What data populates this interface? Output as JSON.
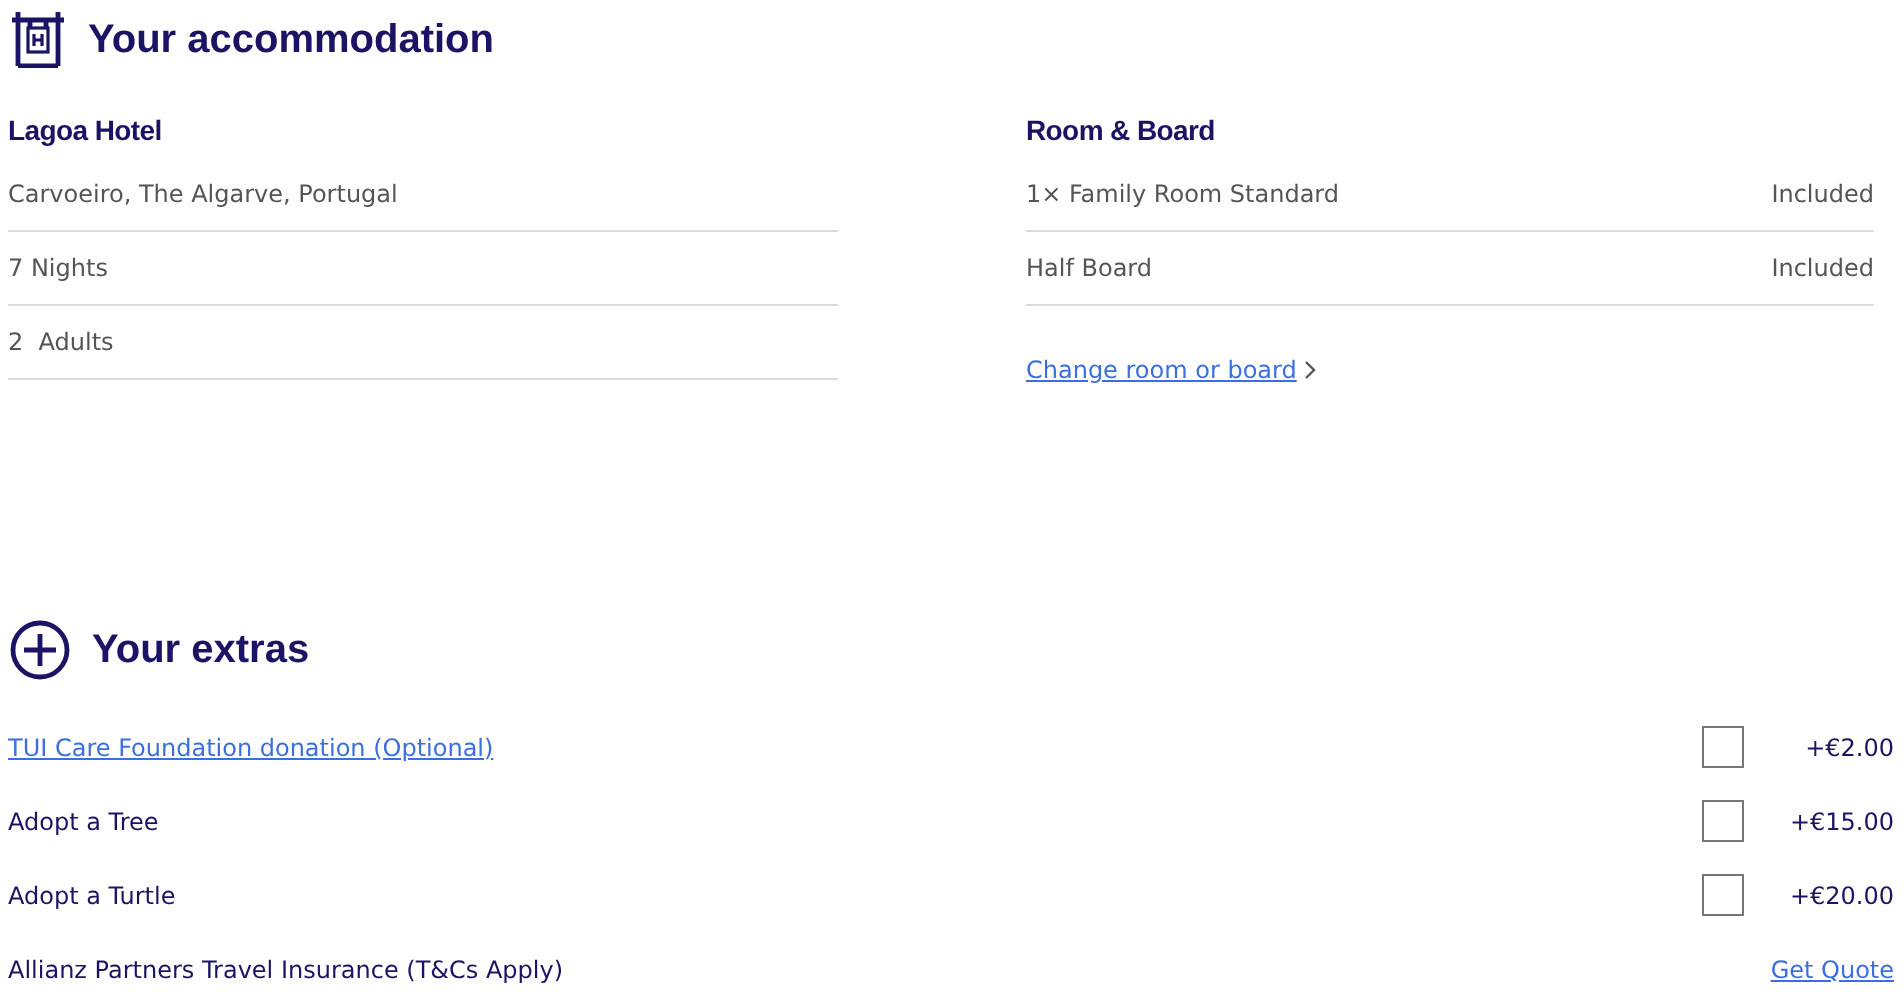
{
  "accommodation": {
    "title": "Your accommodation",
    "hotel": {
      "name": "Lagoa Hotel",
      "details": [
        "Carvoeiro, The Algarve, Portugal",
        "7 Nights",
        "2  Adults"
      ]
    },
    "room_board": {
      "heading": "Room & Board",
      "items": [
        {
          "label": "1× Family Room Standard",
          "value": "Included"
        },
        {
          "label": "Half Board",
          "value": "Included"
        }
      ],
      "change_link": "Change room or board"
    }
  },
  "extras": {
    "title": "Your extras",
    "items": [
      {
        "kind": "link",
        "label": "TUI Care Foundation donation (Optional)",
        "checked": false,
        "price": "+€2.00"
      },
      {
        "kind": "text",
        "label": "Adopt a Tree",
        "checked": false,
        "price": "+€15.00"
      },
      {
        "kind": "text",
        "label": "Adopt a Turtle",
        "checked": false,
        "price": "+€20.00"
      },
      {
        "kind": "quote",
        "label": "Allianz Partners Travel Insurance (T&Cs Apply)",
        "action": "Get Quote"
      }
    ]
  }
}
